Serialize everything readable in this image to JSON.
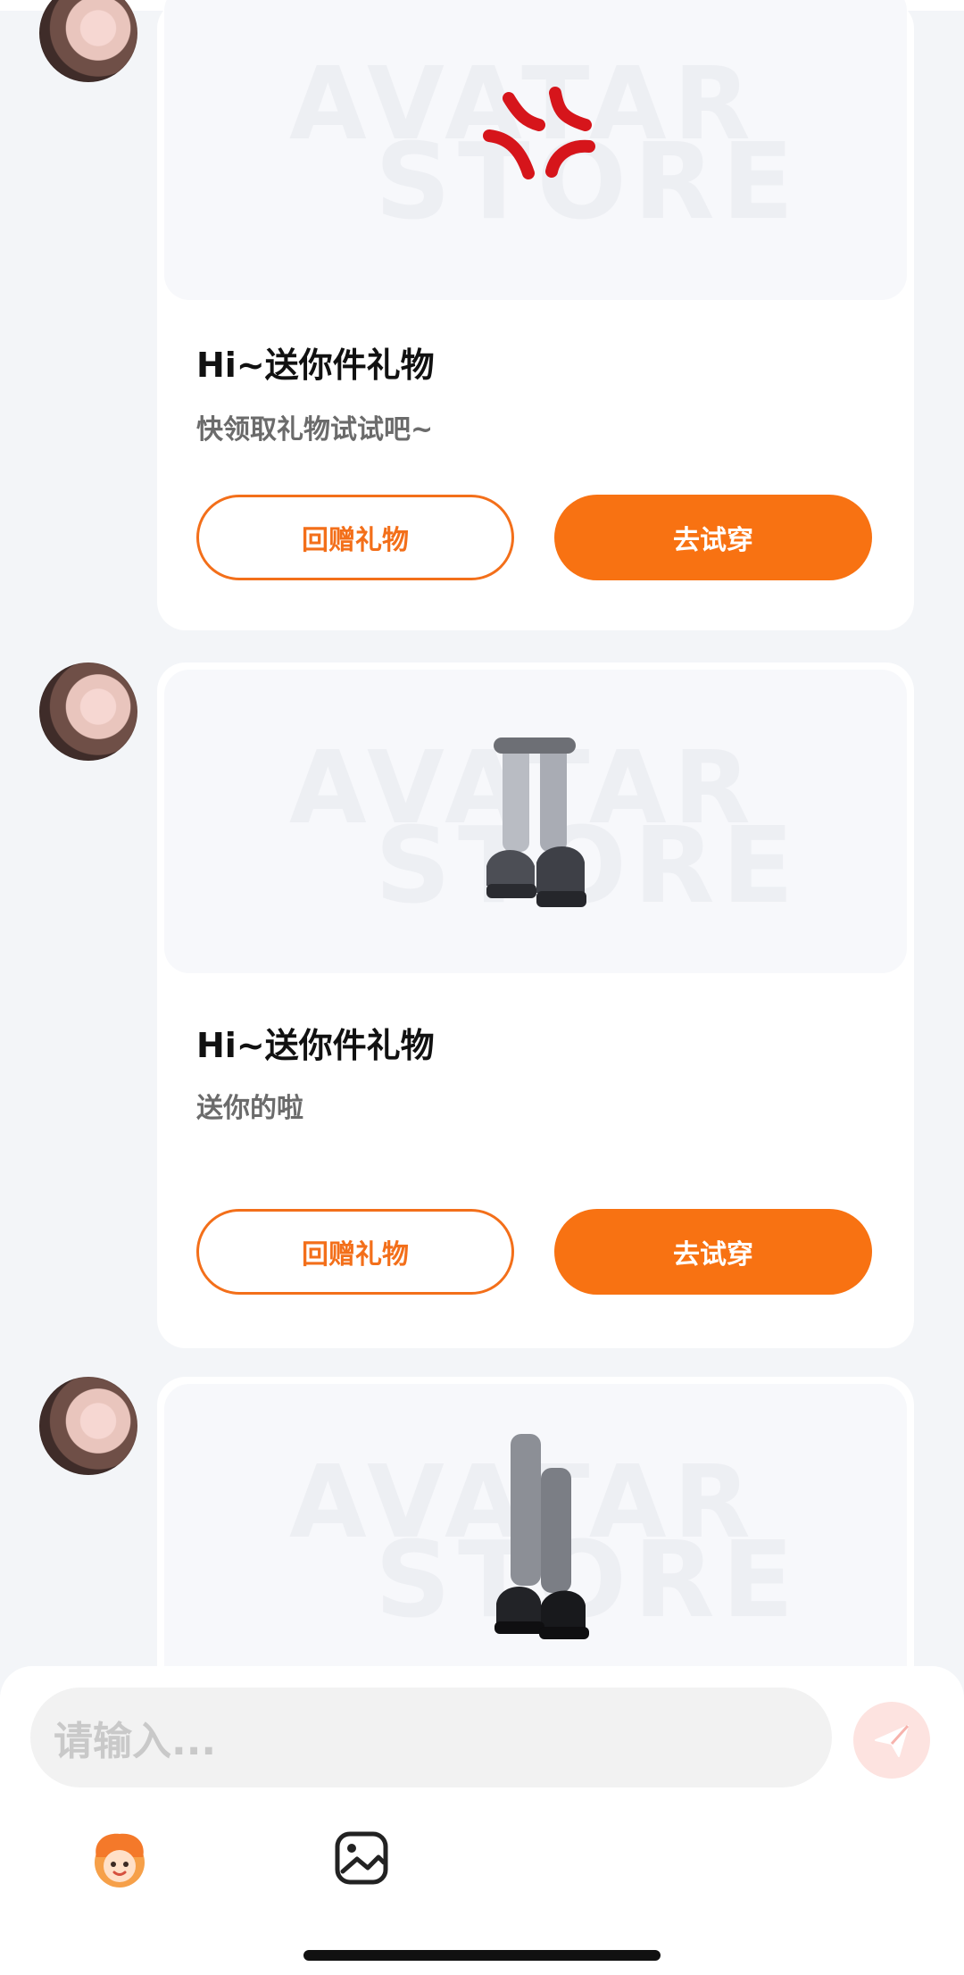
{
  "top_partial_text": "",
  "messages": [
    {
      "title": "Hi~送你件礼物",
      "subtitle": "快领取礼物试试吧~",
      "return_gift": "回赠礼物",
      "try_on": "去试穿"
    },
    {
      "title": "Hi~送你件礼物",
      "subtitle": "送你的啦",
      "return_gift": "回赠礼物",
      "try_on": "去试穿"
    },
    {
      "title": "",
      "subtitle": "",
      "return_gift": "",
      "try_on": ""
    }
  ],
  "watermark": {
    "line1": "AVATAR",
    "line2": "STORE"
  },
  "composer": {
    "placeholder": "请输入..."
  },
  "colors": {
    "accent": "#f87212",
    "card": "#ffffff",
    "bg": "#f3f5f8"
  },
  "icons": [
    "angry-emoji-icon",
    "shoes-socks-icon",
    "boots-socks-icon",
    "send-icon",
    "avatar-icon",
    "image-icon"
  ]
}
